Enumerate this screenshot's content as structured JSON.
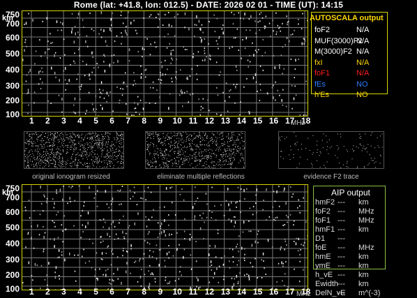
{
  "header": {
    "title": "Rome (lat: +41.8, lon: 012.5) - DATE: 2026 02 01 - TIME (UT): 14:15"
  },
  "top_plot": {
    "y_unit": "km",
    "x_unit": "MHz",
    "y_ticks": [
      "750",
      "700",
      "600",
      "500",
      "400",
      "300",
      "200",
      "100"
    ],
    "x_ticks": [
      "1",
      "2",
      "3",
      "4",
      "5",
      "6",
      "7",
      "8",
      "9",
      "10",
      "11",
      "12",
      "13",
      "14",
      "15",
      "16",
      "17",
      "18"
    ]
  },
  "autoscala": {
    "title": "AUTOSCALA output",
    "rows": [
      {
        "label": "foF2",
        "value": "N/A",
        "color": "#ffffff"
      },
      {
        "label": "MUF(3000)F2",
        "value": "N/A",
        "color": "#ffffff"
      },
      {
        "label": "M(3000)F2",
        "value": "N/A",
        "color": "#ffffff"
      },
      {
        "label": "fxI",
        "value": "N/A",
        "color": "#ffd800"
      },
      {
        "label": "foF1",
        "value": "N/A",
        "color": "#ff1f1f"
      },
      {
        "label": "fEs",
        "value": "NO",
        "color": "#2f7cff"
      },
      {
        "label": "h'Es",
        "value": "NO",
        "color": "#ffd800"
      }
    ]
  },
  "thumbnails": {
    "labels": [
      "original ionogram resized",
      "eliminate multiple reflections",
      "evidence F2 trace"
    ]
  },
  "bottom_plot": {
    "y_unit": "km",
    "x_unit": "MHz",
    "y_ticks": [
      "750",
      "700",
      "600",
      "500",
      "400",
      "300",
      "200",
      "100"
    ],
    "x_ticks": [
      "1",
      "2",
      "3",
      "4",
      "5",
      "6",
      "7",
      "8",
      "9",
      "10",
      "11",
      "12",
      "13",
      "14",
      "15",
      "16",
      "17",
      "18"
    ]
  },
  "aip": {
    "title": "AIP output",
    "rows": [
      {
        "label": "hmF2",
        "dash": "---",
        "unit": "km"
      },
      {
        "label": "foF2",
        "dash": "---",
        "unit": "MHz"
      },
      {
        "label": "foF1",
        "dash": "---",
        "unit": "MHz"
      },
      {
        "label": "hmF1",
        "dash": "---",
        "unit": "km"
      },
      {
        "label": "D1",
        "dash": "---",
        "unit": ""
      },
      {
        "label": "foE",
        "dash": "---",
        "unit": "MHz"
      },
      {
        "label": "hmE",
        "dash": "---",
        "unit": "km"
      },
      {
        "label": "ymE",
        "dash": "---",
        "unit": "km"
      },
      {
        "label": "h_vE",
        "dash": "---",
        "unit": "km"
      },
      {
        "label": "Ewidth",
        "dash": "---",
        "unit": "km"
      },
      {
        "label": "DelN_vE",
        "dash": "---",
        "unit": "m^(-3)"
      }
    ]
  }
}
